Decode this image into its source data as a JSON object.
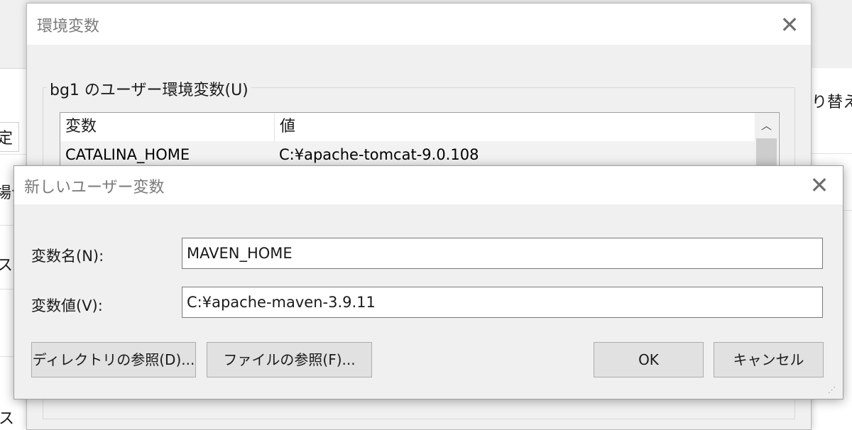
{
  "background": {
    "fragments": {
      "tab_fragment": "定",
      "left_fragment_1": "場合",
      "left_fragment_2": "スメ",
      "right_fragment": "り替え",
      "bottom_fragment": "ス"
    }
  },
  "env_window": {
    "title": "環境変数",
    "close_glyph": "✕",
    "group_label": "bg1 のユーザー環境変数(U)",
    "list": {
      "columns": [
        "変数",
        "値"
      ],
      "rows": [
        {
          "name": "CATALINA_HOME",
          "value": "C:¥apache-tomcat-9.0.108"
        }
      ],
      "scroll_up_glyph": "︿"
    }
  },
  "dialog": {
    "title": "新しいユーザー変数",
    "close_glyph": "✕",
    "name_label": "変数名(N):",
    "name_value": "MAVEN_HOME",
    "value_label": "変数値(V):",
    "value_value": "C:¥apache-maven-3.9.11",
    "buttons": {
      "browse_dir": "ディレクトリの参照(D)...",
      "browse_file": "ファイルの参照(F)...",
      "ok": "OK",
      "cancel": "キャンセル"
    },
    "grip_glyph": "⋰"
  }
}
